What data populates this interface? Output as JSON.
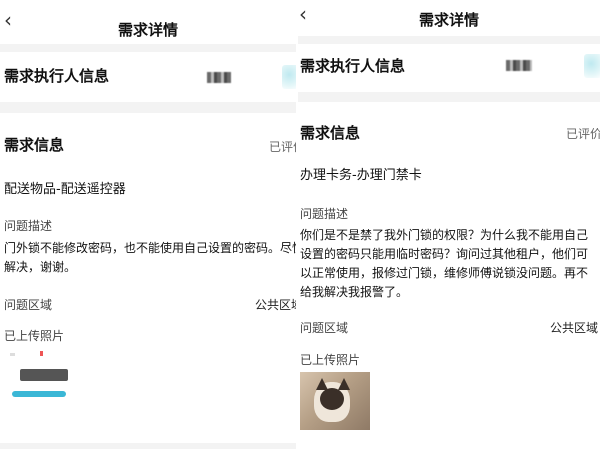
{
  "left": {
    "header": {
      "title": "需求详情"
    },
    "executor_title": "需求执行人信息",
    "info_title": "需求信息",
    "status": "已评价",
    "service": "配送物品-配送遥控器",
    "desc_label": "问题描述",
    "desc_text": "门外锁不能修改密码，也不能使用自己设置的密码。尽快解决，谢谢。",
    "area_label": "问题区域",
    "area_value": "公共区域",
    "photos_label": "已上传照片"
  },
  "right": {
    "header": {
      "title": "需求详情"
    },
    "executor_title": "需求执行人信息",
    "info_title": "需求信息",
    "status": "已评价",
    "service": "办理卡务-办理门禁卡",
    "desc_label": "问题描述",
    "desc_text": "你们是不是禁了我外门锁的权限？为什么我不能用自己设置的密码只能用临时密码？询问过其他租户，他们可以正常使用，报修过门锁，维修师傅说锁没问题。再不给我解决我报警了。",
    "area_label": "问题区域",
    "area_value": "公共区域",
    "photos_label": "已上传照片"
  },
  "icons": {
    "back": "chevron-left-icon"
  }
}
